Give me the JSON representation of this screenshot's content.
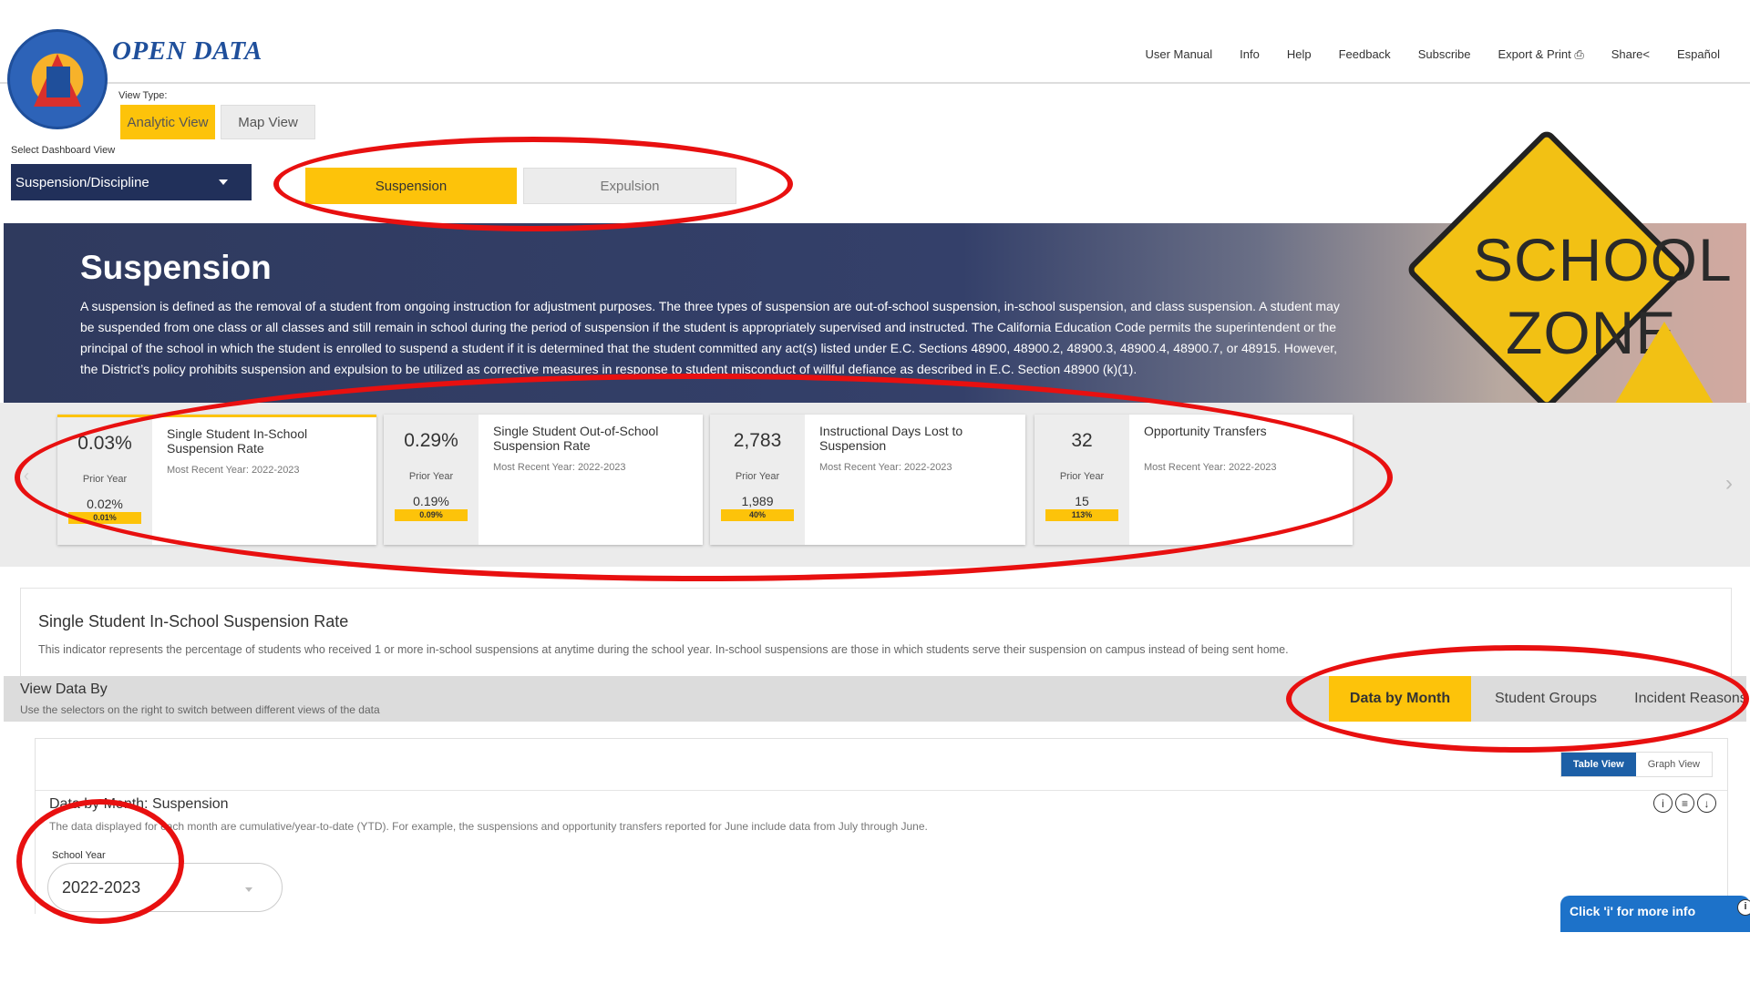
{
  "header": {
    "brand": "OPEN DATA",
    "nav": [
      "User Manual",
      "Info",
      "Help",
      "Feedback",
      "Subscribe",
      "Export & Print",
      "Share",
      "Español"
    ]
  },
  "view_type": {
    "label": "View Type:",
    "analytic": "Analytic View",
    "map": "Map View"
  },
  "dashboard": {
    "label": "Select Dashboard View",
    "selected": "Suspension/Discipline",
    "tabs": [
      "Suspension",
      "Expulsion"
    ]
  },
  "hero": {
    "title": "Suspension",
    "description": "A suspension is defined as the removal of a student from ongoing instruction for adjustment purposes. The three types of suspension are out-of-school suspension, in-school suspension, and class suspension. A student may be suspended from one class or all classes and still remain in school during the period of suspension if the student is appropriately supervised and instructed. The California Education Code permits the superintendent or the principal of the school in which the student is enrolled to suspend a student if it is determined that the student committed any act(s) listed under E.C. Sections 48900, 48900.2, 48900.3, 48900.4, 48900.7, or 48915. However, the District’s policy prohibits suspension and expulsion to be utilized as corrective measures in response to student misconduct of willful defiance as described in E.C. Section 48900 (k)(1).",
    "sign_line1": "SCHOOL",
    "sign_line2": "ZONE"
  },
  "kpis": [
    {
      "value": "0.03%",
      "prior_label": "Prior Year",
      "prior": "0.02%",
      "change": "0.01%",
      "name": "Single Student In-School Suspension Rate",
      "year": "Most Recent Year: 2022-2023"
    },
    {
      "value": "0.29%",
      "prior_label": "Prior Year",
      "prior": "0.19%",
      "change": "0.09%",
      "name": "Single Student Out-of-School Suspension Rate",
      "year": "Most Recent Year: 2022-2023"
    },
    {
      "value": "2,783",
      "prior_label": "Prior Year",
      "prior": "1,989",
      "change": "40%",
      "name": "Instructional Days Lost to Suspension",
      "year": "Most Recent Year: 2022-2023"
    },
    {
      "value": "32",
      "prior_label": "Prior Year",
      "prior": "15",
      "change": "113%",
      "name": "Opportunity Transfers",
      "year": "Most Recent Year: 2022-2023"
    }
  ],
  "indicator": {
    "title": "Single Student In-School Suspension Rate",
    "description": "This indicator represents the percentage of students who received 1 or more in-school suspensions at anytime during the school year. In-school suspensions are those in which students serve their suspension on campus instead of being sent home."
  },
  "view_data_by": {
    "title": "View Data By",
    "description": "Use the selectors on the right to switch between different views of the data",
    "tabs": [
      "Data by Month",
      "Student Groups",
      "Incident Reasons"
    ]
  },
  "panel": {
    "toggle_table": "Table View",
    "toggle_graph": "Graph View",
    "title": "Data by Month: Suspension",
    "description": "The data displayed for each month are cumulative/year-to-date (YTD). For example, the suspensions and opportunity transfers reported for June include data from July through June.",
    "school_year_label": "School Year",
    "school_year_value": "2022-2023",
    "info_pill": "Click 'i' for more info"
  },
  "colors": {
    "accent": "#fdc30a",
    "navy": "#21305a",
    "annotation": "#e81010",
    "link_blue": "#1d5fa6"
  }
}
